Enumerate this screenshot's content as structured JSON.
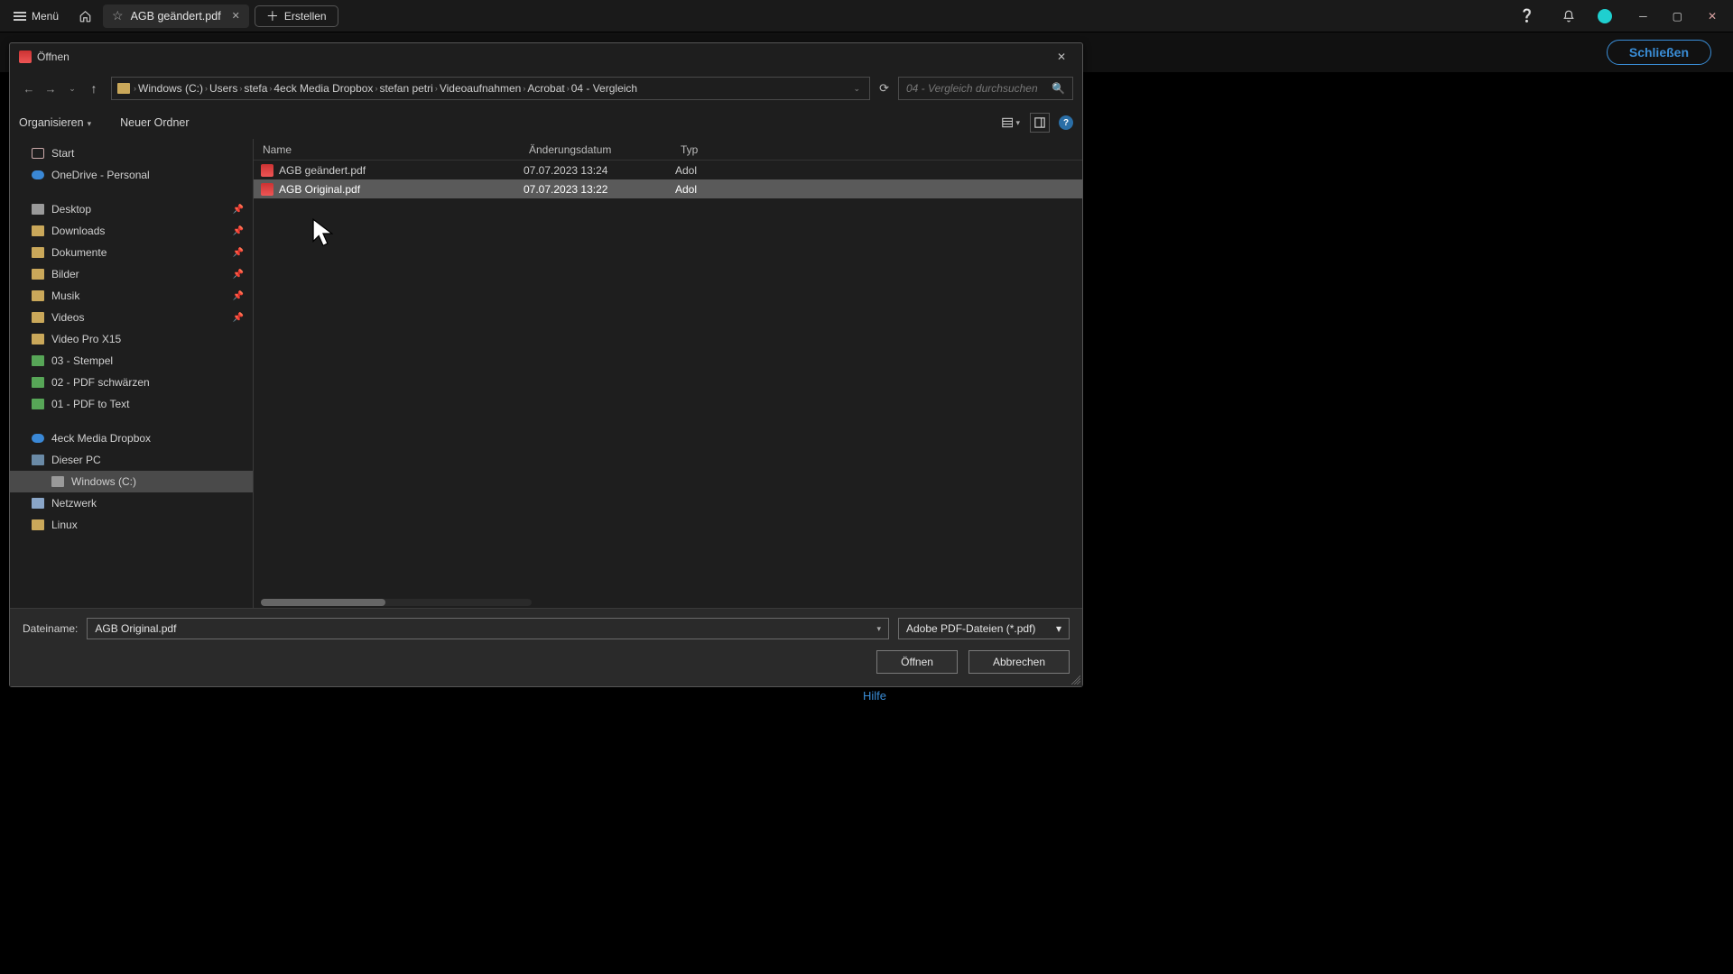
{
  "topbar": {
    "menu_label": "Menü",
    "tab_title": "AGB geändert.pdf",
    "create_label": "Erstellen"
  },
  "subbar": {
    "close_label": "Schließen"
  },
  "dialog": {
    "title": "Öffnen",
    "nav": {
      "crumbs": [
        "Windows (C:)",
        "Users",
        "stefa",
        "4eck Media Dropbox",
        "stefan petri",
        "Videoaufnahmen",
        "Acrobat",
        "04 - Vergleich"
      ]
    },
    "search_placeholder": "04 - Vergleich durchsuchen",
    "toolbar": {
      "organize": "Organisieren",
      "new_folder": "Neuer Ordner"
    },
    "tree": {
      "items": [
        {
          "label": "Start",
          "icon": "home"
        },
        {
          "label": "OneDrive - Personal",
          "icon": "cloud"
        },
        {
          "sep": true
        },
        {
          "label": "Desktop",
          "icon": "disk",
          "pin": true
        },
        {
          "label": "Downloads",
          "icon": "folder",
          "pin": true
        },
        {
          "label": "Dokumente",
          "icon": "folder",
          "pin": true
        },
        {
          "label": "Bilder",
          "icon": "folder",
          "pin": true
        },
        {
          "label": "Musik",
          "icon": "folder",
          "pin": true
        },
        {
          "label": "Videos",
          "icon": "folder",
          "pin": true
        },
        {
          "label": "Video Pro X15",
          "icon": "folder"
        },
        {
          "label": "03 - Stempel",
          "icon": "folderg"
        },
        {
          "label": "02 - PDF schwärzen",
          "icon": "folderg"
        },
        {
          "label": "01 - PDF to Text",
          "icon": "folderg"
        },
        {
          "sep": true
        },
        {
          "label": "4eck Media Dropbox",
          "icon": "cloud"
        },
        {
          "label": "Dieser PC",
          "icon": "pc"
        },
        {
          "label": "Windows (C:)",
          "icon": "disk",
          "level": 2,
          "sel": true
        },
        {
          "label": "Netzwerk",
          "icon": "net"
        },
        {
          "label": "Linux",
          "icon": "folder"
        }
      ]
    },
    "columns": {
      "name": "Name",
      "date": "Änderungsdatum",
      "type": "Typ"
    },
    "files": [
      {
        "name": "AGB geändert.pdf",
        "date": "07.07.2023 13:24",
        "type": "Adol"
      },
      {
        "name": "AGB Original.pdf",
        "date": "07.07.2023 13:22",
        "type": "Adol",
        "sel": true
      }
    ],
    "footer": {
      "filename_label": "Dateiname:",
      "filename_value": "AGB Original.pdf",
      "filetype_value": "Adobe PDF-Dateien (*.pdf)",
      "open": "Öffnen",
      "cancel": "Abbrechen"
    }
  },
  "hilfe": "Hilfe"
}
